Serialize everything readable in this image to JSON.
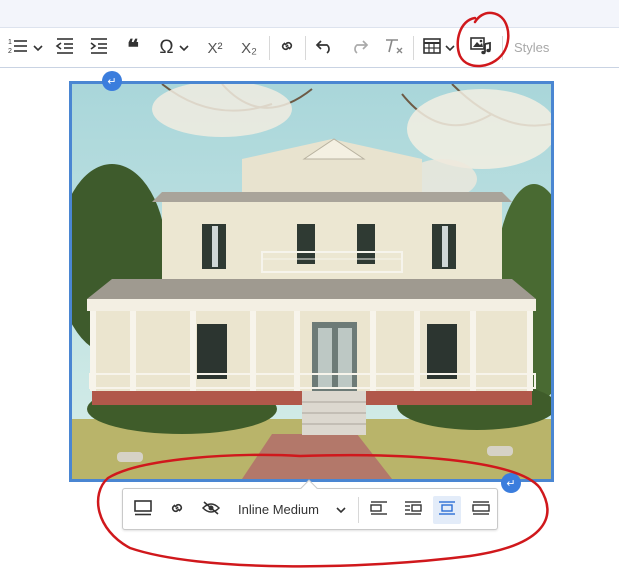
{
  "toolbar": {
    "numbered_list": "1 2",
    "superscript": "X²",
    "subscript": "X₂",
    "omega": "Ω",
    "blockquote": "❝",
    "styles_placeholder": "Styles"
  },
  "image_toolbar": {
    "resize_option": "Inline Medium",
    "active_alignment": "center"
  },
  "colors": {
    "accent": "#4a86d2",
    "annotation": "#d0181c"
  }
}
